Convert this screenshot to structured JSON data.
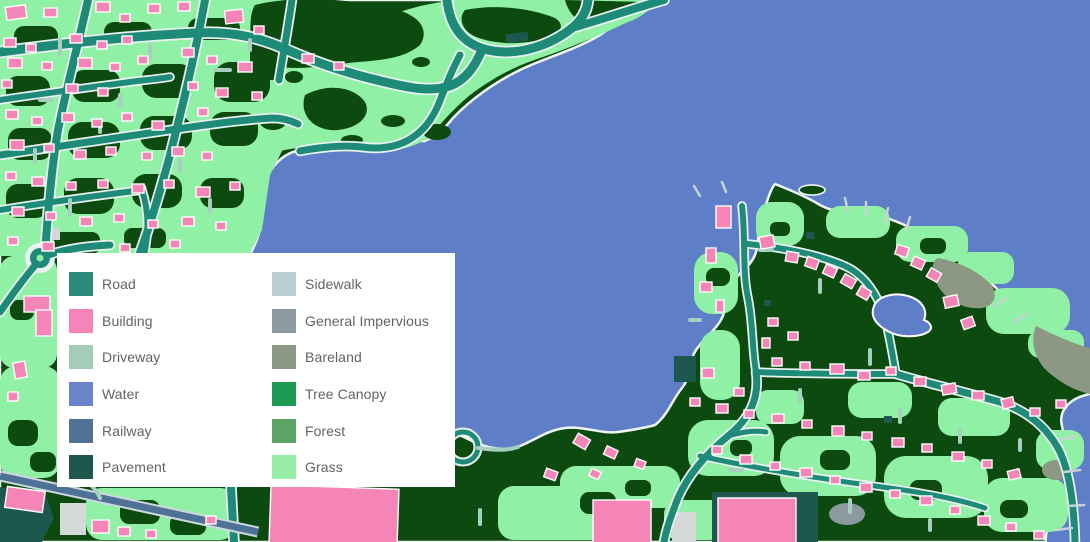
{
  "map": {
    "type_label": "land-cover-map"
  },
  "legend": {
    "columns": [
      {
        "items": [
          {
            "label": "Road",
            "color": "#2e8b77"
          },
          {
            "label": "Building",
            "color": "#f585b7"
          },
          {
            "label": "Driveway",
            "color": "#a3cdb9"
          },
          {
            "label": "Water",
            "color": "#6b84c9"
          },
          {
            "label": "Railway",
            "color": "#4f7296"
          },
          {
            "label": "Pavement",
            "color": "#1d574d"
          }
        ]
      },
      {
        "items": [
          {
            "label": "Sidewalk",
            "color": "#b9ced3"
          },
          {
            "label": "General Impervious",
            "color": "#8c99a1"
          },
          {
            "label": "Bareland",
            "color": "#8c9884"
          },
          {
            "label": "Tree Canopy",
            "color": "#1d9b55"
          },
          {
            "label": "Forest",
            "color": "#5ba466"
          },
          {
            "label": "Grass",
            "color": "#97efa7"
          }
        ]
      }
    ]
  },
  "palette": {
    "water": "#5e7ec7",
    "canopy": "#0d4a10",
    "grass": "#90f1a6",
    "road": "#1e8a78",
    "casing": "#e9f2ee",
    "building": "#f585b7",
    "bstroke": "#ffffff",
    "driveway": "#a6cfc0",
    "railway": "#4e7295",
    "railcasing": "#ccd8de",
    "pavement": "#1d574d",
    "impervious": "#8c99a1",
    "lightgray": "#d4d9d8",
    "bareland": "#8c9884",
    "dock": "#c7d2d5",
    "shore": "#eef5f2"
  }
}
